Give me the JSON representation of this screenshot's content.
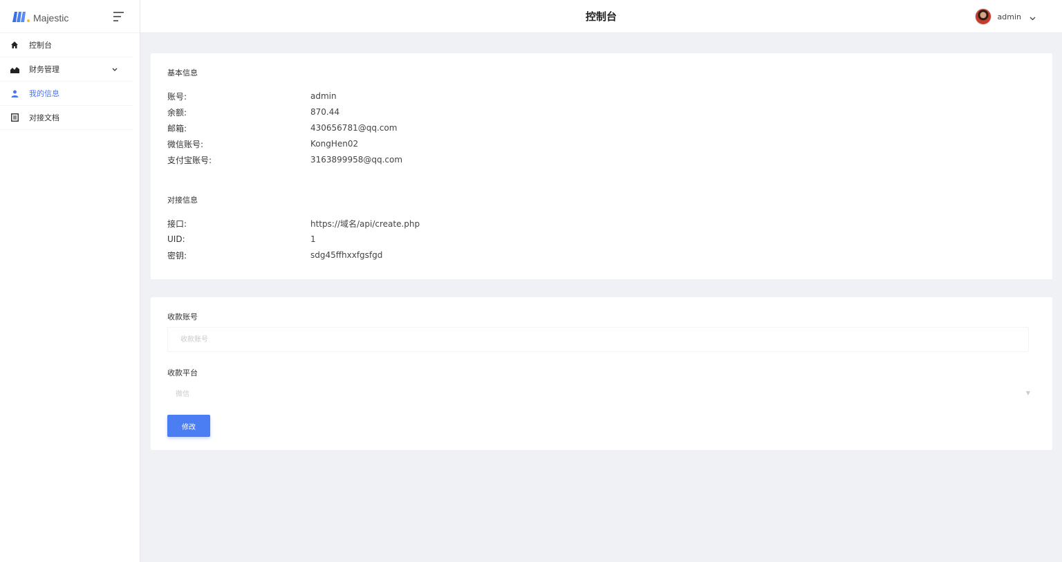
{
  "brand": {
    "name": "Majestic"
  },
  "sidebar": {
    "items": [
      {
        "label": "控制台",
        "icon": "home-icon"
      },
      {
        "label": "财务管理",
        "icon": "chart-area-icon",
        "has_submenu": true
      },
      {
        "label": "我的信息",
        "icon": "user-icon",
        "active": true
      },
      {
        "label": "对接文档",
        "icon": "document-icon"
      }
    ]
  },
  "header": {
    "title": "控制台",
    "user_name": "admin"
  },
  "basic_info": {
    "title": "基本信息",
    "rows": [
      {
        "label": "账号:",
        "value": "admin"
      },
      {
        "label": "余额:",
        "value": "870.44"
      },
      {
        "label": "邮箱:",
        "value": "430656781@qq.com"
      },
      {
        "label": "微信账号:",
        "value": "KongHen02"
      },
      {
        "label": "支付宝账号:",
        "value": "3163899958@qq.com"
      }
    ]
  },
  "api_info": {
    "title": "对接信息",
    "rows": [
      {
        "label": "接口:",
        "value": "https://域名/api/create.php"
      },
      {
        "label": "UID:",
        "value": "1"
      },
      {
        "label": "密钥:",
        "value": "sdg45ffhxxfgsfgd"
      }
    ]
  },
  "payee_form": {
    "account_label": "收款账号",
    "account_placeholder": "收款账号",
    "platform_label": "收款平台",
    "platform_selected": "微信",
    "submit_label": "修改"
  },
  "colors": {
    "accent": "#4b7ef2",
    "background": "#f0f1f5"
  }
}
